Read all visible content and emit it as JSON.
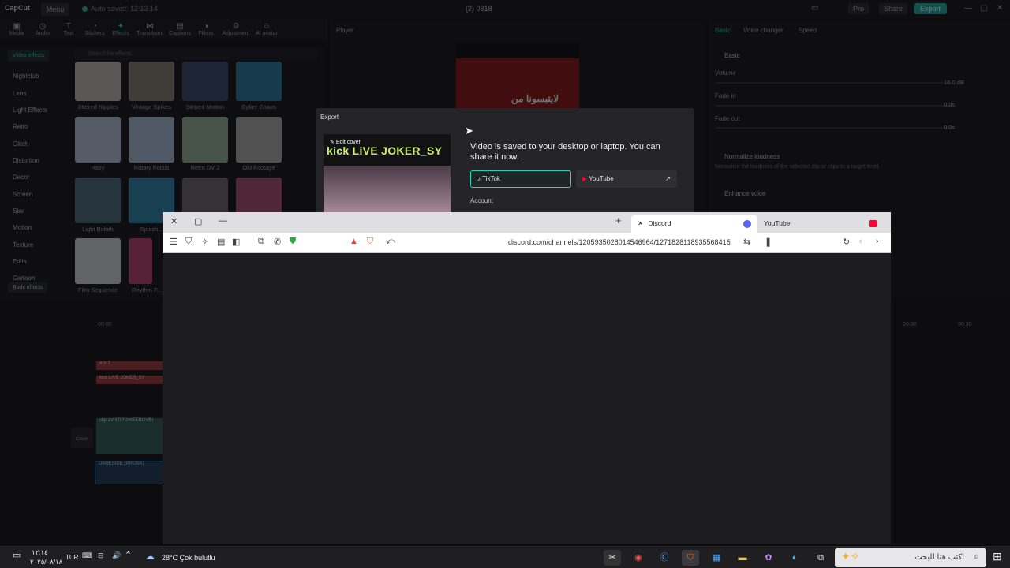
{
  "capcut": {
    "logo": "CapCut",
    "menu_label": "Menu",
    "autosave": "Auto saved: 12:13:14",
    "project_title": "(2) 0818",
    "pro": "Pro",
    "share": "Share",
    "export": "Export",
    "tools": [
      "Media",
      "Audio",
      "Text",
      "Stickers",
      "Effects",
      "Transitions",
      "Captions",
      "Filters",
      "Adjustment",
      "AI avatar"
    ],
    "video_effects_label": "Video effects",
    "search_placeholder": "Search for effects",
    "categories": [
      "Nightclub",
      "Lens",
      "Light Effects",
      "Retro",
      "Glitch",
      "Distortion",
      "Decor",
      "Screen",
      "Star",
      "Motion",
      "Texture",
      "Edits",
      "Cartoon"
    ],
    "body_effects_label": "Body effects",
    "effects": [
      "Jittered Ripples",
      "Vintage Spikes",
      "Striped Motion",
      "Cyber Chaos",
      "Hazy",
      "Rotary Focus",
      "Retro DV 2",
      "Old Footage",
      "Light Bokeh",
      "Splash...",
      "",
      "",
      "Film Sequence",
      "Rhythm F..."
    ],
    "player_label": "Player",
    "player_overlay_text": "لايتبسونا من",
    "right_tabs": [
      "Basic",
      "Voice changer",
      "Speed"
    ],
    "basic_label": "Basic",
    "volume_label": "Volume",
    "volume_value": "10.0 dB",
    "fadein_label": "Fade in",
    "fadein_value": "0.0s",
    "fadeout_label": "Fade out",
    "fadeout_value": "0.0s",
    "normalize_label": "Normalize loudness",
    "normalize_desc": "Normalize the loudness of the selected clip or clips to a target level.",
    "enhance_label": "Enhance voice",
    "timeline": {
      "time_00": "00:00",
      "time_right1": "00:30",
      "time_right2": "00:30",
      "clip1": "# Y T",
      "clip2": "kick LiVE JOKER_SY",
      "clip3": "clip 1VNTIPOWTEBOVEI",
      "clip4": "DARKSIDE (PHONK)",
      "cover": "Cover"
    }
  },
  "export_dialog": {
    "title": "Export",
    "edit_cover": "Edit cover",
    "cover_text": "kick LiVE JOKER_SY",
    "message": "Video is saved to your desktop or laptop. You can share it now.",
    "tiktok": "TikTok",
    "youtube": "YouTube",
    "account": "Account"
  },
  "browser": {
    "tabs": [
      {
        "label": "Discord",
        "active": true
      },
      {
        "label": "YouTube",
        "active": false
      }
    ],
    "url": "discord.com/channels/1205935028014546964/1271828118935568415"
  },
  "taskbar": {
    "time": "١٢:١٤",
    "date": "٢٠٢٥/٠٨/١٨",
    "lang": "TUR",
    "weather": "28°C  Çok bulutlu",
    "search_placeholder": "اكتب هنا للبحث"
  },
  "colors": {
    "accent": "#25d3c0",
    "discord": "#5865f2",
    "youtube": "#ff0033"
  }
}
